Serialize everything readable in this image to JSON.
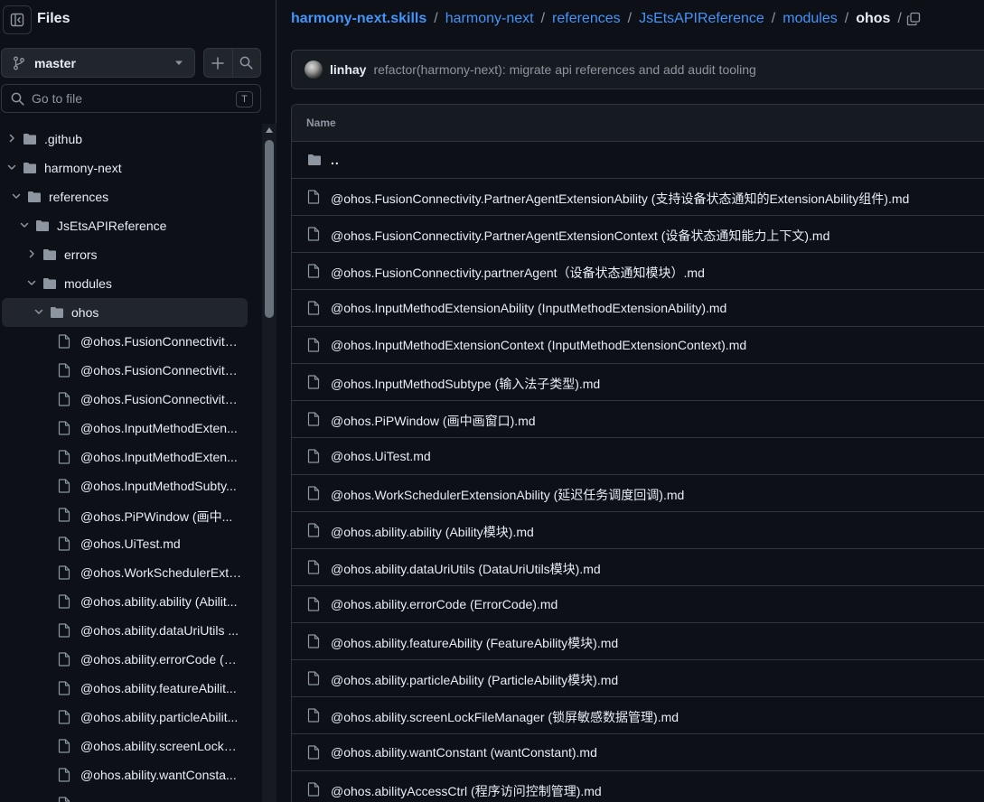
{
  "sidebar": {
    "title": "Files",
    "branch": "master",
    "search_placeholder": "Go to file",
    "search_shortcut": "T",
    "tree": [
      {
        "label": ".github",
        "type": "folder",
        "depth": 0,
        "expanded": false
      },
      {
        "label": "harmony-next",
        "type": "folder",
        "depth": 0,
        "expanded": true
      },
      {
        "label": "references",
        "type": "folder",
        "depth": 1,
        "expanded": true
      },
      {
        "label": "JsEtsAPIReference",
        "type": "folder",
        "depth": 2,
        "expanded": true
      },
      {
        "label": "errors",
        "type": "folder",
        "depth": 3,
        "expanded": false
      },
      {
        "label": "modules",
        "type": "folder",
        "depth": 3,
        "expanded": true
      },
      {
        "label": "ohos",
        "type": "folder",
        "depth": 4,
        "expanded": true,
        "selected": true
      },
      {
        "label": "@ohos.FusionConnectivity....",
        "type": "file",
        "depth": 5
      },
      {
        "label": "@ohos.FusionConnectivity....",
        "type": "file",
        "depth": 5
      },
      {
        "label": "@ohos.FusionConnectivity....",
        "type": "file",
        "depth": 5
      },
      {
        "label": "@ohos.InputMethodExten...",
        "type": "file",
        "depth": 5
      },
      {
        "label": "@ohos.InputMethodExten...",
        "type": "file",
        "depth": 5
      },
      {
        "label": "@ohos.InputMethodSubty...",
        "type": "file",
        "depth": 5
      },
      {
        "label": "@ohos.PiPWindow (画中...",
        "type": "file",
        "depth": 5
      },
      {
        "label": "@ohos.UiTest.md",
        "type": "file",
        "depth": 5
      },
      {
        "label": "@ohos.WorkSchedulerExte...",
        "type": "file",
        "depth": 5
      },
      {
        "label": "@ohos.ability.ability (Abilit...",
        "type": "file",
        "depth": 5
      },
      {
        "label": "@ohos.ability.dataUriUtils ...",
        "type": "file",
        "depth": 5
      },
      {
        "label": "@ohos.ability.errorCode (E...",
        "type": "file",
        "depth": 5
      },
      {
        "label": "@ohos.ability.featureAbilit...",
        "type": "file",
        "depth": 5
      },
      {
        "label": "@ohos.ability.particleAbilit...",
        "type": "file",
        "depth": 5
      },
      {
        "label": "@ohos.ability.screenLockFi...",
        "type": "file",
        "depth": 5
      },
      {
        "label": "@ohos.ability.wantConsta...",
        "type": "file",
        "depth": 5
      },
      {
        "label": "",
        "type": "file",
        "depth": 5
      }
    ]
  },
  "breadcrumb": {
    "repo": "harmony-next.skills",
    "parts": [
      "harmony-next",
      "references",
      "JsEtsAPIReference",
      "modules"
    ],
    "current": "ohos",
    "separator": "/"
  },
  "commit": {
    "author": "linhay",
    "message": "refactor(harmony-next): migrate api references and add audit tooling"
  },
  "table": {
    "header": "Name",
    "parent_label": "..",
    "files": [
      "@ohos.FusionConnectivity.PartnerAgentExtensionAbility (支持设备状态通知的ExtensionAbility组件).md",
      "@ohos.FusionConnectivity.PartnerAgentExtensionContext (设备状态通知能力上下文).md",
      "@ohos.FusionConnectivity.partnerAgent（设备状态通知模块）.md",
      "@ohos.InputMethodExtensionAbility (InputMethodExtensionAbility).md",
      "@ohos.InputMethodExtensionContext (InputMethodExtensionContext).md",
      "@ohos.InputMethodSubtype (输入法子类型).md",
      "@ohos.PiPWindow (画中画窗口).md",
      "@ohos.UiTest.md",
      "@ohos.WorkSchedulerExtensionAbility (延迟任务调度回调).md",
      "@ohos.ability.ability (Ability模块).md",
      "@ohos.ability.dataUriUtils (DataUriUtils模块).md",
      "@ohos.ability.errorCode (ErrorCode).md",
      "@ohos.ability.featureAbility (FeatureAbility模块).md",
      "@ohos.ability.particleAbility (ParticleAbility模块).md",
      "@ohos.ability.screenLockFileManager (锁屏敏感数据管理).md",
      "@ohos.ability.wantConstant (wantConstant).md",
      "@ohos.abilityAccessCtrl (程序访问控制管理).md"
    ]
  },
  "colors": {
    "bg": "#0d1117",
    "border": "#30363d",
    "link": "#4493f8",
    "muted": "#8d96a0",
    "text": "#e6edf3"
  },
  "icons": [
    "sidebar-panel-icon",
    "git-branch-icon",
    "triangle-down-icon",
    "plus-icon",
    "search-icon",
    "chevron-right-icon",
    "chevron-down-icon",
    "folder-icon",
    "file-icon",
    "copy-icon"
  ]
}
